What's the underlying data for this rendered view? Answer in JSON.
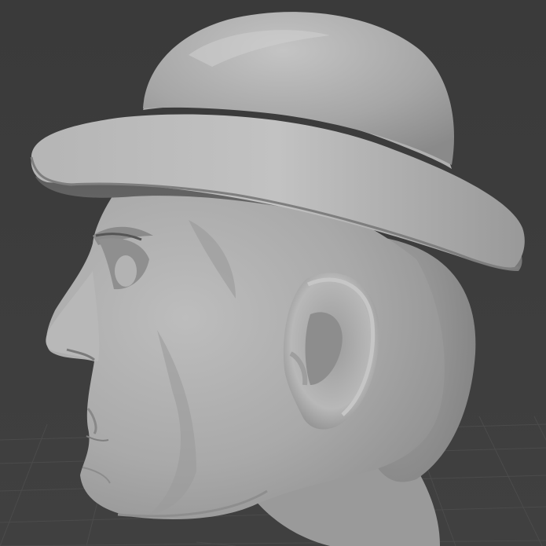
{
  "viewport": {
    "background": "#3d3d3d",
    "grid_line_color": "#4a4a4a",
    "model": "head-with-bowler-hat",
    "shading": "solid-matcap",
    "model_color": "#a9a9a9"
  }
}
